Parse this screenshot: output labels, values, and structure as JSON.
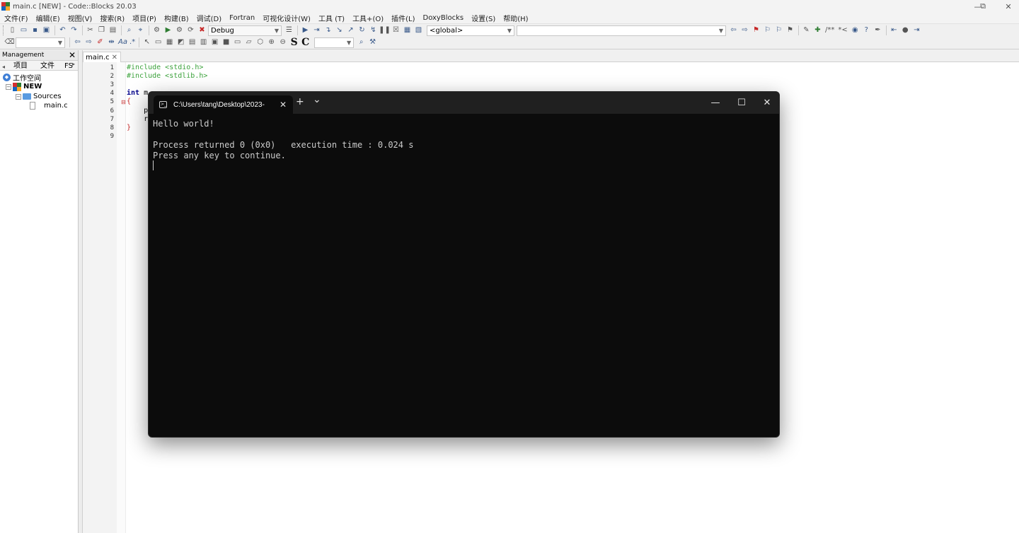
{
  "window": {
    "title": "main.c [NEW] - Code::Blocks 20.03",
    "minimize": "—",
    "restore": "⧉",
    "close": "✕"
  },
  "menu": [
    "文件(F)",
    "编辑(E)",
    "视图(V)",
    "搜索(R)",
    "项目(P)",
    "构建(B)",
    "调试(D)",
    "Fortran",
    "可视化设计(W)",
    "工具 (T)",
    "工具+(O)",
    "插件(L)",
    "DoxyBlocks",
    "设置(S)",
    "帮助(H)"
  ],
  "toolbar": {
    "build_target": "Debug",
    "scope": "<global>",
    "function": "",
    "search": "",
    "zoom": "",
    "doxy_comment": "/**",
    "doxy_line": "*<",
    "bold_s": "S",
    "bold_c": "C"
  },
  "management": {
    "title": "Management",
    "close": "✕",
    "tabs": [
      "项目",
      "文件",
      "FS"
    ],
    "tree": {
      "workspace": "工作空间",
      "project": "NEW",
      "folder": "Sources",
      "file": "main.c"
    }
  },
  "editor": {
    "tab_label": "main.c",
    "tab_close": "✕",
    "line_numbers": [
      "1",
      "2",
      "3",
      "4",
      "5",
      "6",
      "7",
      "8",
      "9"
    ],
    "lines": {
      "l1": "#include <stdio.h>",
      "l2": "#include <stdlib.h>",
      "l4_kw": "int",
      "l4_rest": " m",
      "l5": "{",
      "l6": "    p",
      "l7": "    r",
      "l8": "}"
    }
  },
  "terminal": {
    "tab_title": "C:\\Users\\tang\\Desktop\\2023-",
    "tab_close": "✕",
    "new_tab": "+",
    "dropdown": "⌄",
    "minimize": "—",
    "maximize": "☐",
    "close": "✕",
    "output_line1": "Hello world!",
    "output_line2": "",
    "output_line3": "Process returned 0 (0x0)   execution time : 0.024 s",
    "output_line4": "Press any key to continue."
  }
}
